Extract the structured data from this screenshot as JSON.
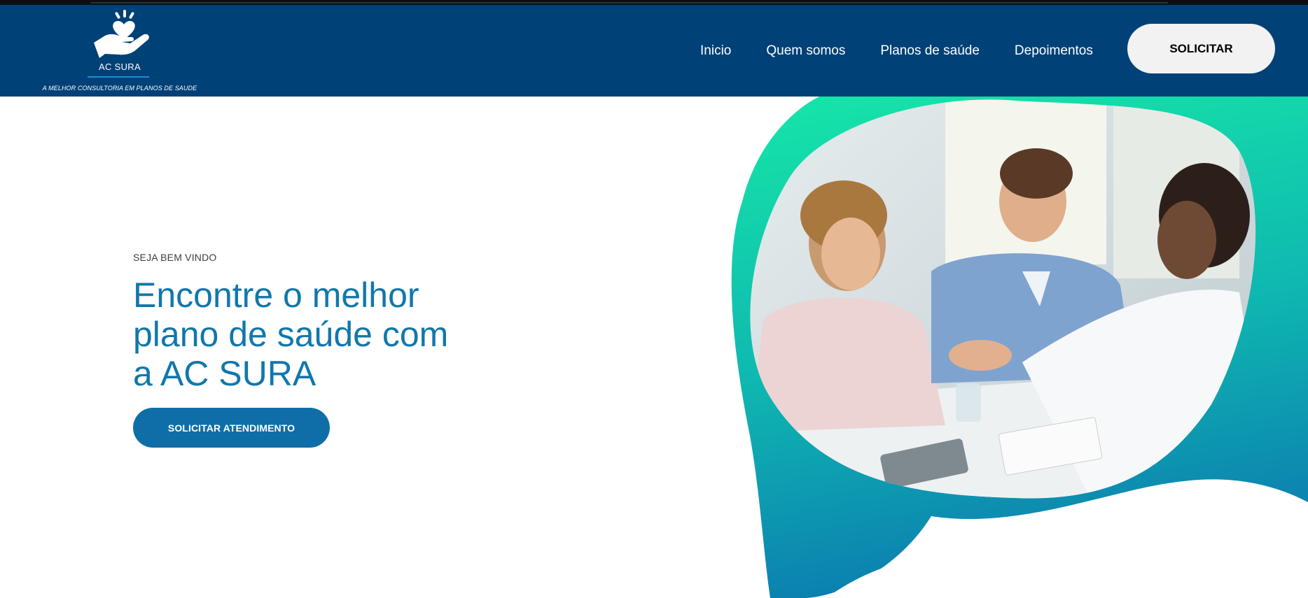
{
  "brand": {
    "name": "AC SURA",
    "tagline": "A MELHOR CONSULTORIA EM PLANOS DE SAUDE",
    "logo_icon": "hand-holding-heart-icon"
  },
  "nav": {
    "items": [
      {
        "label": "Inicio"
      },
      {
        "label": "Quem somos"
      },
      {
        "label": "Planos de saúde"
      },
      {
        "label": "Depoimentos"
      }
    ],
    "cta_label": "SOLICITAR"
  },
  "hero": {
    "eyebrow": "SEJA BEM VINDO",
    "headline_lines": [
      "Encontre o melhor",
      "plano de saúde com",
      "a AC SURA"
    ],
    "cta_label": "SOLICITAR ATENDIMENTO",
    "image_subject": "doctor-consultation-photo"
  },
  "colors": {
    "header_bg": "#004177",
    "headline": "#1177ac",
    "cta_main_bg": "#0f6ea8",
    "cta_top_bg": "#f2f2f2",
    "blob_gradient_top": "#16e6a8",
    "blob_gradient_bottom": "#0c7fb0"
  }
}
